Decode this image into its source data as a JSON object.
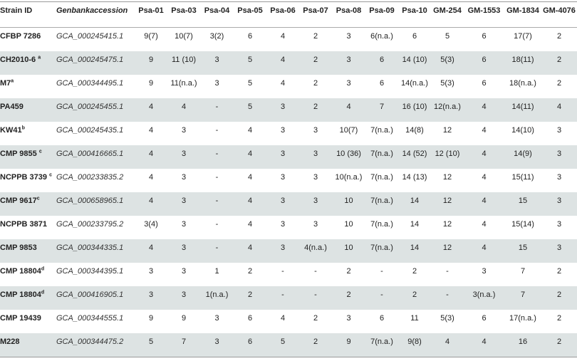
{
  "headers": [
    "Strain ID",
    "Genbankaccession",
    "Psa-01",
    "Psa-03",
    "Psa-04",
    "Psa-05",
    "Psa-06",
    "Psa-07",
    "Psa-08",
    "Psa-09",
    "Psa-10",
    "GM-254",
    "GM-1553",
    "GM-1834",
    "GM-4076"
  ],
  "rows": [
    {
      "strain": "CFBP 7286",
      "sup": "",
      "acc": "GCA_000245415.1",
      "v": [
        "9(7)",
        "10(7)",
        "3(2)",
        "6",
        "4",
        "2",
        "3",
        "6(n.a.)",
        "6",
        "5",
        "6",
        "17(7)",
        "2"
      ]
    },
    {
      "strain": "CH2010-6 ",
      "sup": "a",
      "acc": "GCA_000245475.1",
      "v": [
        "9",
        "11 (10)",
        "3",
        "5",
        "4",
        "2",
        "3",
        "6",
        "14 (10)",
        "5(3)",
        "6",
        "18(11)",
        "2"
      ]
    },
    {
      "strain": "M7",
      "sup": "a",
      "acc": "GCA_000344495.1",
      "v": [
        "9",
        "11(n.a.)",
        "3",
        "5",
        "4",
        "2",
        "3",
        "6",
        "14(n.a.)",
        "5(3)",
        "6",
        "18(n.a.)",
        "2"
      ]
    },
    {
      "strain": "PA459",
      "sup": "",
      "acc": "GCA_000245455.1",
      "v": [
        "4",
        "4",
        "-",
        "5",
        "3",
        "2",
        "4",
        "7",
        "16 (10)",
        "12(n.a.)",
        "4",
        "14(11)",
        "4"
      ]
    },
    {
      "strain": "KW41",
      "sup": "b",
      "acc": "GCA_000245435.1",
      "v": [
        "4",
        "3",
        "-",
        "4",
        "3",
        "3",
        "10(7)",
        "7(n.a.)",
        "14(8)",
        "12",
        "4",
        "14(10)",
        "3"
      ]
    },
    {
      "strain": "CMP 9855 ",
      "sup": "c",
      "acc": "GCA_000416665.1",
      "v": [
        "4",
        "3",
        "-",
        "4",
        "3",
        "3",
        "10 (36)",
        "7(n.a.)",
        "14 (52)",
        "12 (10)",
        "4",
        "14(9)",
        "3"
      ]
    },
    {
      "strain": "NCPPB 3739 ",
      "sup": "c",
      "acc": "GCA_000233835.2",
      "v": [
        "4",
        "3",
        "-",
        "4",
        "3",
        "3",
        "10(n.a.)",
        "7(n.a.)",
        "14 (13)",
        "12",
        "4",
        "15(11)",
        "3"
      ]
    },
    {
      "strain": "CMP 9617",
      "sup": "c",
      "acc": "GCA_000658965.1",
      "v": [
        "4",
        "3",
        "-",
        "4",
        "3",
        "3",
        "10",
        "7(n.a.)",
        "14",
        "12",
        "4",
        "15",
        "3"
      ]
    },
    {
      "strain": "NCPPB 3871",
      "sup": "",
      "acc": "GCA_000233795.2",
      "v": [
        "3(4)",
        "3",
        "-",
        "4",
        "3",
        "3",
        "10",
        "7(n.a.)",
        "14",
        "12",
        "4",
        "15(14)",
        "3"
      ]
    },
    {
      "strain": "CMP 9853",
      "sup": "",
      "acc": "GCA_000344335.1",
      "v": [
        "4",
        "3",
        "-",
        "4",
        "3",
        "4(n.a.)",
        "10",
        "7(n.a.)",
        "14",
        "12",
        "4",
        "15",
        "3"
      ]
    },
    {
      "strain": "CMP 18804",
      "sup": "d",
      "acc": "GCA_000344395.1",
      "v": [
        "3",
        "3",
        "1",
        "2",
        "-",
        "-",
        "2",
        "-",
        "2",
        "-",
        "3",
        "7",
        "2"
      ]
    },
    {
      "strain": "CMP 18804",
      "sup": "d",
      "acc": "GCA_000416905.1",
      "v": [
        "3",
        "3",
        "1(n.a.)",
        "2",
        "-",
        "-",
        "2",
        "-",
        "2",
        "-",
        "3(n.a.)",
        "7",
        "2"
      ]
    },
    {
      "strain": "CMP 19439",
      "sup": "",
      "acc": "GCA_000344555.1",
      "v": [
        "9",
        "9",
        "3",
        "6",
        "4",
        "2",
        "3",
        "6",
        "11",
        "5(3)",
        "6",
        "17(n.a.)",
        "2"
      ]
    },
    {
      "strain": "M228",
      "sup": "",
      "acc": "GCA_000344475.2",
      "v": [
        "5",
        "7",
        "3",
        "6",
        "5",
        "2",
        "9",
        "7(n.a.)",
        "9(8)",
        "4",
        "4",
        "16",
        "2"
      ]
    }
  ]
}
